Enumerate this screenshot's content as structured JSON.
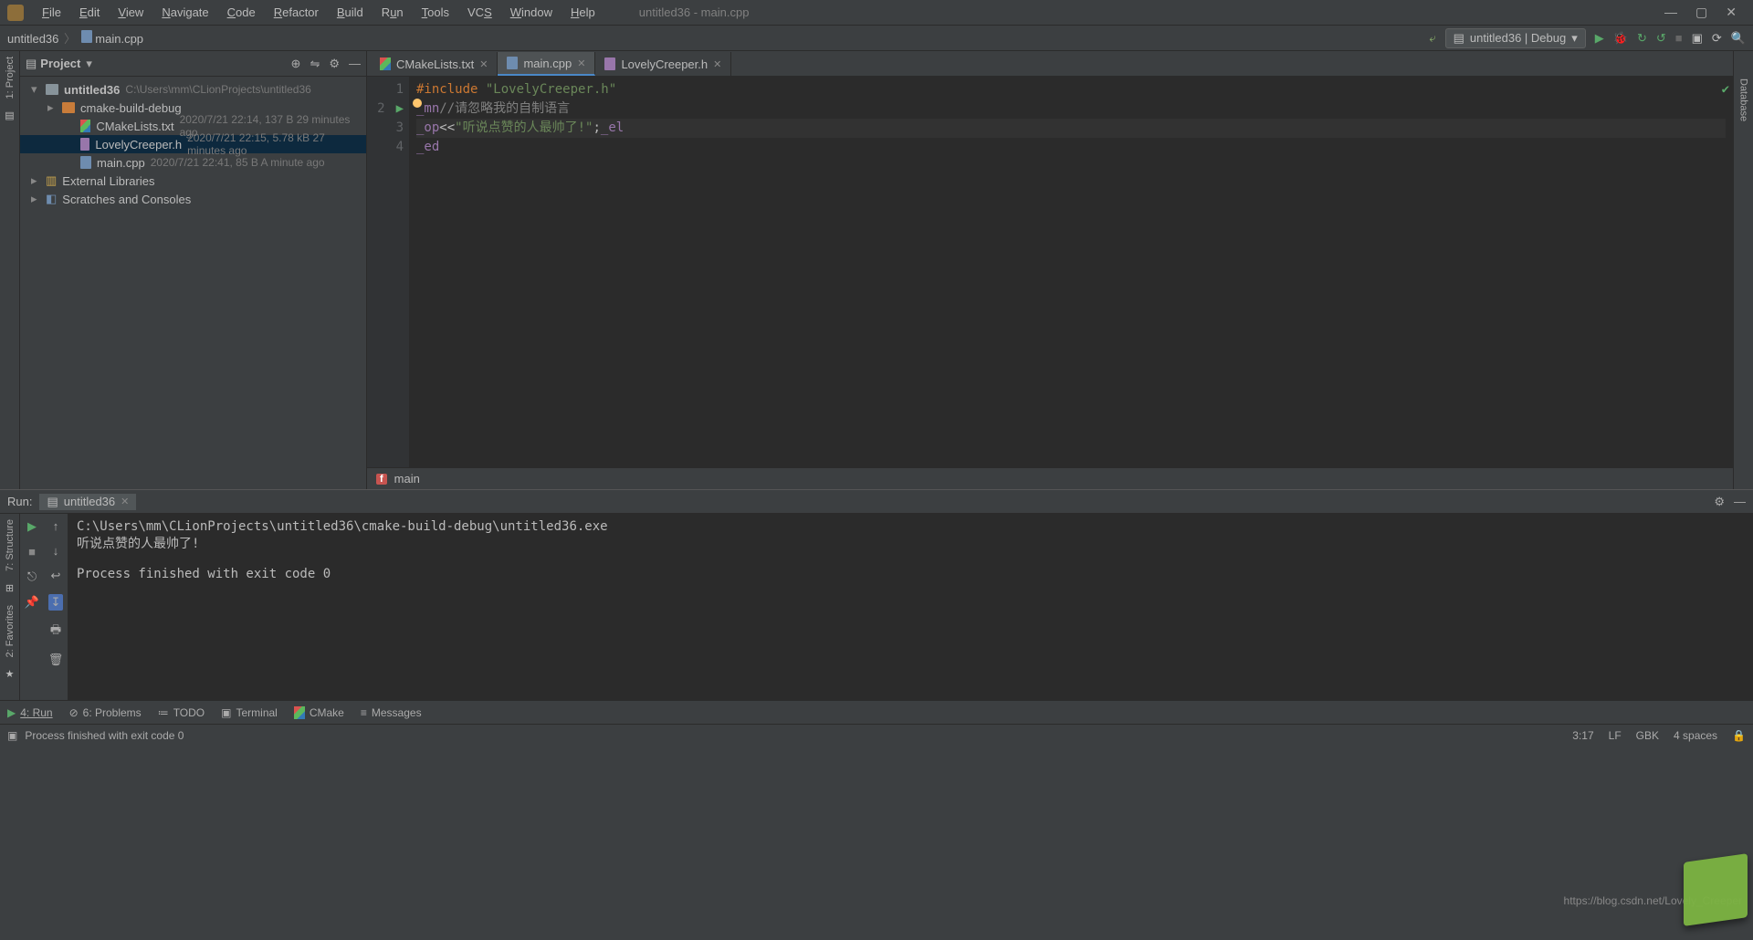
{
  "menubar": [
    "File",
    "Edit",
    "View",
    "Navigate",
    "Code",
    "Refactor",
    "Build",
    "Run",
    "Tools",
    "VCS",
    "Window",
    "Help"
  ],
  "window_title": "untitled36 - main.cpp",
  "breadcrumb": {
    "project": "untitled36",
    "file": "main.cpp"
  },
  "run_config": {
    "label": "untitled36 | Debug"
  },
  "project_panel": {
    "title": "Project",
    "root": {
      "name": "untitled36",
      "path": "C:\\Users\\mm\\CLionProjects\\untitled36"
    },
    "folder_cmake": "cmake-build-debug",
    "files": [
      {
        "name": "CMakeLists.txt",
        "meta": "2020/7/21 22:14, 137 B 29 minutes ago",
        "type": "cmake"
      },
      {
        "name": "LovelyCreeper.h",
        "meta": "2020/7/21 22:15, 5.78 kB 27 minutes ago",
        "type": "h",
        "selected": true
      },
      {
        "name": "main.cpp",
        "meta": "2020/7/21 22:41, 85 B A minute ago",
        "type": "cpp"
      }
    ],
    "external": "External Libraries",
    "scratches": "Scratches and Consoles"
  },
  "editor_tabs": [
    {
      "label": "CMakeLists.txt",
      "type": "cmake",
      "active": false
    },
    {
      "label": "main.cpp",
      "type": "cpp",
      "active": true
    },
    {
      "label": "LovelyCreeper.h",
      "type": "h",
      "active": false
    }
  ],
  "editor": {
    "lines": {
      "l1_kw": "#include ",
      "l1_str": "\"LovelyCreeper.h\"",
      "l2_fn": "_mn",
      "l2_cm": "//请忽略我的自制语言",
      "l3_fn1": "_op",
      "l3_op": "<<",
      "l3_str": "\"听说点赞的人最帅了!\"",
      "l3_sc": ";",
      "l3_fn2": "_el",
      "l4_fn": "_ed"
    },
    "context_badge": "f",
    "context_label": "main"
  },
  "run_panel": {
    "label": "Run:",
    "target": "untitled36",
    "console_lines": [
      "C:\\Users\\mm\\CLionProjects\\untitled36\\cmake-build-debug\\untitled36.exe",
      "听说点赞的人最帅了!",
      "",
      "Process finished with exit code 0"
    ]
  },
  "bottom_tabs": {
    "run": "4: Run",
    "problems": "6: Problems",
    "todo": "TODO",
    "terminal": "Terminal",
    "cmake": "CMake",
    "messages": "Messages"
  },
  "status": {
    "msg": "Process finished with exit code 0",
    "pos": "3:17",
    "le": "LF",
    "enc": "GBK",
    "indent": "4 spaces"
  },
  "left_gutter_label": "1: Project",
  "right_gutter_label": "Database",
  "side_labels": {
    "structure": "7: Structure",
    "favorites": "2: Favorites"
  },
  "watermark": "https://blog.csdn.net/Lovely_Creeper"
}
